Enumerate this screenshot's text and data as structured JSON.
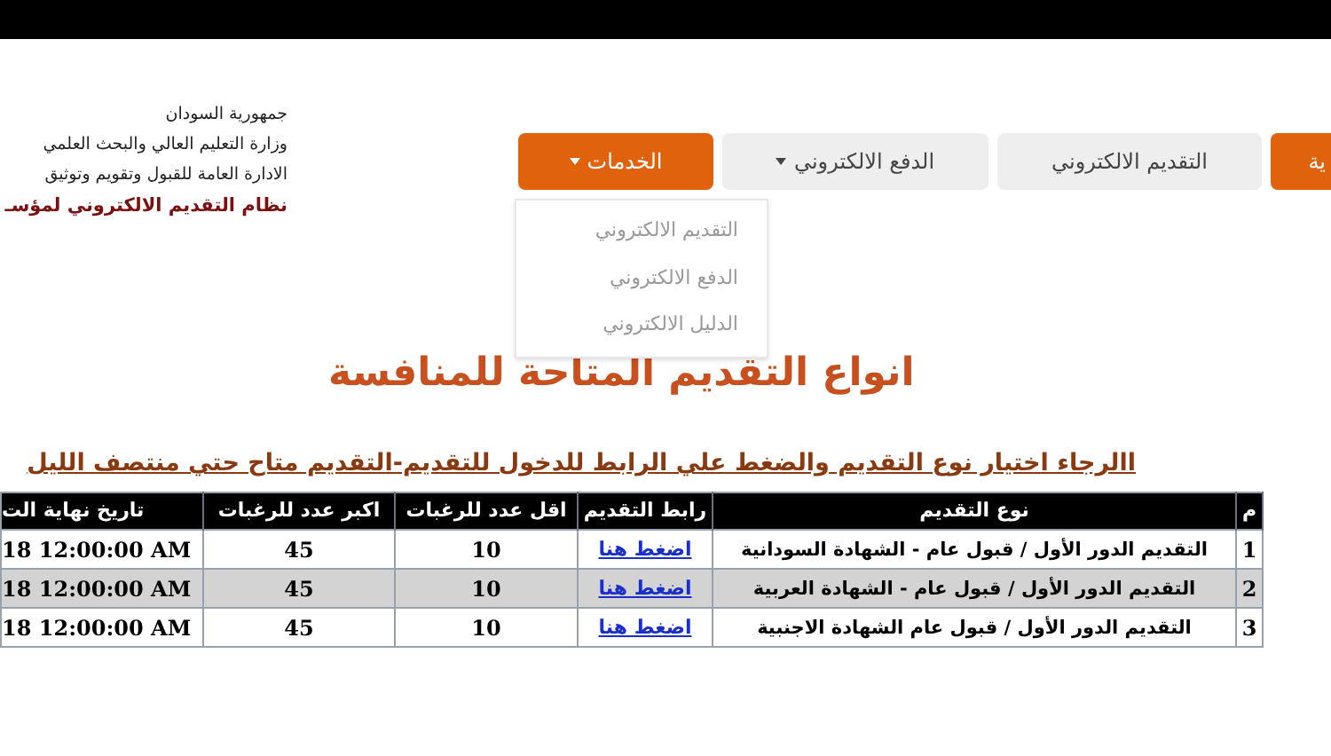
{
  "header": {
    "lines": [
      {
        "text": "جمهورية السودان",
        "kind": "plain"
      },
      {
        "text": "وزارة التعليم العالي والبحث العلمي",
        "kind": "plain"
      },
      {
        "text": "الادارة العامة للقبول وتقويم وتوثيق",
        "kind": "plain"
      },
      {
        "text": "نظام التقديم الالكتروني لمؤسـ",
        "kind": "title"
      }
    ]
  },
  "nav": {
    "items": [
      {
        "label": "ية",
        "highlighted": true,
        "has_menu": false
      },
      {
        "label": "التقديم الالكتروني",
        "highlighted": false,
        "has_menu": false
      },
      {
        "label": "الدفع الالكتروني",
        "highlighted": false,
        "has_menu": true
      },
      {
        "label": "الخدمات",
        "highlighted": true,
        "has_menu": true
      }
    ],
    "dropdown": {
      "items": [
        "التقديم الالكتروني",
        "الدفع الالكتروني",
        "الدليل الالكتروني"
      ]
    }
  },
  "page_title": "انواع التقديم المتاحة للمنافسة",
  "instruction": "االرجاء اختيار نوع التقديم والضغط علي الرابط للدخول للتقديم-التقديم متاح حتي منتصف الليل",
  "table": {
    "columns": [
      "م",
      "نوع التقديم",
      "رابط التقديم",
      "اقل عدد للرغبات",
      "اكبر عدد للرغبات",
      "تاريخ نهاية الت"
    ],
    "rows": [
      {
        "num": "1",
        "type": "التقديم الدور الأول / قبول عام - الشهادة السودانية",
        "link": "اضغط هنا",
        "min": "10",
        "max": "45",
        "deadline": "18 12:00:00 AM"
      },
      {
        "num": "2",
        "type": "التقديم الدور الأول / قبول عام - الشهادة العربية",
        "link": "اضغط هنا",
        "min": "10",
        "max": "45",
        "deadline": "18 12:00:00 AM"
      },
      {
        "num": "3",
        "type": "التقديم الدور الأول / قبول عام الشهادة الاجنبية",
        "link": "اضغط هنا",
        "min": "10",
        "max": "45",
        "deadline": "18 12:00:00 AM"
      }
    ]
  }
}
